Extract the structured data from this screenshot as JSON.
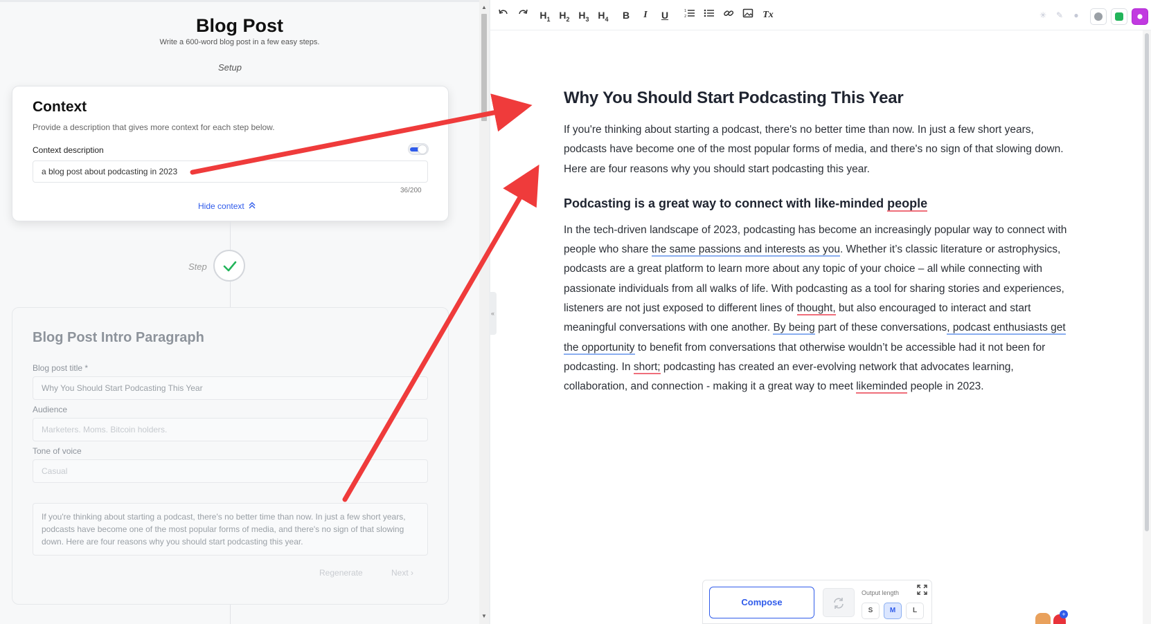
{
  "left": {
    "title": "Blog Post",
    "subtitle": "Write a 600-word blog post in a few easy steps.",
    "setup_label": "Setup",
    "context_card": {
      "heading": "Context",
      "description": "Provide a description that gives more context for each step below.",
      "field_label": "Context description",
      "field_value": "a blog post about podcasting in 2023",
      "counter": "36/200",
      "hide_label": "Hide context",
      "toggle_on": true
    },
    "step_label": "Step",
    "step_card": {
      "heading": "Blog Post Intro Paragraph",
      "title_label": "Blog post title *",
      "title_value": "Why You Should Start Podcasting This Year",
      "audience_label": "Audience",
      "audience_placeholder": "Marketers. Moms. Bitcoin holders.",
      "tone_label": "Tone of voice",
      "tone_placeholder": "Casual",
      "intro_text": "If you're thinking about starting a podcast, there's no better time than now. In just a few short years, podcasts have become one of the most popular forms of media, and there's no sign of that slowing down. Here are four reasons why you should start podcasting this year.",
      "regenerate_label": "Regenerate",
      "next_label": "Next ›"
    }
  },
  "toolbar": {
    "undo_icon": "undo-icon",
    "redo_icon": "redo-icon",
    "h1": "H",
    "h2": "H",
    "h3": "H",
    "h4": "H",
    "bold": "B",
    "italic": "I",
    "underline": "U",
    "ordered_list_icon": "ordered-list-icon",
    "bullet_list_icon": "bullet-list-icon",
    "link_icon": "link-icon",
    "image_icon": "image-icon",
    "clear_format": "Tx"
  },
  "editor": {
    "title": "Why You Should Start Podcasting This Year",
    "intro": "If you're thinking about starting a podcast, there's no better time than now. In just a few short years, podcasts have become one of the most popular forms of media, and there's no sign of that slowing down. Here are four reasons why you should start podcasting this year.",
    "section_heading_pre": "Podcasting is a great way to connect with like-minded ",
    "section_heading_flag": "people",
    "body": {
      "s1": "In the tech-driven landscape of 2023, podcasting has become an increasingly popular way to connect with people who share ",
      "s2": "the same passions and interests as you",
      "s3": ". Whether it’s classic literature or astrophysics, podcasts are a great platform to learn more about any topic of your choice – all while connecting with passionate individuals from all walks of life. With podcasting as a tool for sharing stories and experiences, listeners are not just exposed to different lines of ",
      "s4": "thought,",
      "s5": " but also encouraged to interact and start meaningful conversations with one another. ",
      "s6": "By being",
      "s7": " part of these conversations",
      "s8": ", podcast enthusiasts get the opportunity",
      "s9": " to benefit from conversations that otherwise wouldn’t be accessible had it not been for podcasting. In ",
      "s10": "short;",
      "s11": " podcasting has created an ever-evolving network that advocates learning, collaboration, and connection - making it a great way to meet ",
      "s12": "likeminded",
      "s13": " people in 2023."
    }
  },
  "compose": {
    "compose_label": "Compose",
    "output_length_label": "Output length",
    "sizes": [
      "S",
      "M",
      "L"
    ],
    "selected_size": "M"
  },
  "colors": {
    "accent": "#2f5bea",
    "arrow": "#ef3b3b",
    "check": "#22b45a"
  }
}
